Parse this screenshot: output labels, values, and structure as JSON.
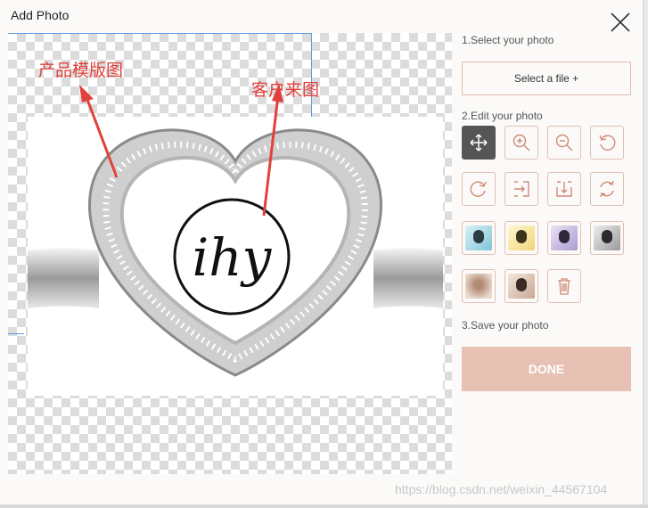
{
  "dialog": {
    "title": "Add Photo"
  },
  "annotations": {
    "product_template": "产品模版图",
    "customer_image": "客户来图"
  },
  "logo_text": "ihy",
  "steps": {
    "select": "1.Select your photo",
    "select_button": "Select a file +",
    "edit": "2.Edit your photo",
    "save": "3.Save your photo",
    "done_button": "DONE"
  },
  "tools": [
    "move-icon",
    "zoom-in-icon",
    "zoom-out-icon",
    "rotate-left-icon",
    "rotate-right-icon",
    "fit-width-icon",
    "fit-height-icon",
    "reset-icon"
  ],
  "filters": [
    "filter-cyan",
    "filter-yellow",
    "filter-purple",
    "filter-gray",
    "filter-blur",
    "filter-normal"
  ],
  "watermark": "https://blog.csdn.net/weixin_44567104",
  "colors": {
    "accent_border": "#e1bfb3",
    "done_bg": "#e6c1b4",
    "annotation": "#e2403b",
    "active_tool": "#555555"
  }
}
